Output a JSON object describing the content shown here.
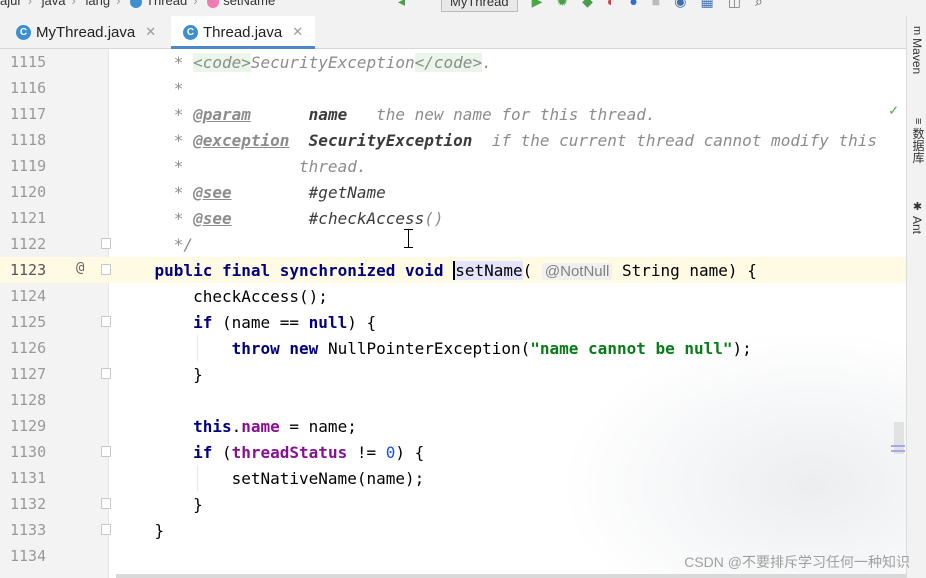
{
  "breadcrumb": {
    "items": [
      "ajur",
      "java",
      "lang",
      "Thread",
      "setName"
    ]
  },
  "toolbar": {
    "run_config": "MyThread",
    "icons": [
      "hammer-icon",
      "run-icon",
      "debug-icon",
      "coverage-icon",
      "profile-icon",
      "stop-icon",
      "search-icon"
    ]
  },
  "tabs": [
    {
      "label": "MyThread.java",
      "icon": "class-icon",
      "active": false
    },
    {
      "label": "Thread.java",
      "icon": "class-icon",
      "active": true
    }
  ],
  "right_tools": [
    "Maven",
    "数据库",
    "Ant"
  ],
  "editor": {
    "current_line": "1123",
    "lines": [
      {
        "n": "1115"
      },
      {
        "n": "1116"
      },
      {
        "n": "1117"
      },
      {
        "n": "1118"
      },
      {
        "n": "1119"
      },
      {
        "n": "1120"
      },
      {
        "n": "1121"
      },
      {
        "n": "1122"
      },
      {
        "n": "1123"
      },
      {
        "n": "1124"
      },
      {
        "n": "1125"
      },
      {
        "n": "1126"
      },
      {
        "n": "1127"
      },
      {
        "n": "1128"
      },
      {
        "n": "1129"
      },
      {
        "n": "1130"
      },
      {
        "n": "1131"
      },
      {
        "n": "1132"
      },
      {
        "n": "1133"
      },
      {
        "n": "1134"
      }
    ],
    "t": {
      "star": "*",
      "code_open": "<code>",
      "security_exception": "SecurityException",
      "code_close": "</code>",
      "dot": ".",
      "param_tag": "@param",
      "name": "name",
      "param_desc": "the new name for this thread.",
      "exception_tag": "@exception",
      "exception_desc": "if the current thread cannot modify this",
      "thread_desc": "thread.",
      "see_tag": "@see",
      "see_get_name": "#getName",
      "see_check_access": "#checkAccess",
      "parens": "()",
      "end_comment": "*/",
      "kw_public": "public",
      "kw_final": "final",
      "kw_synchronized": "synchronized",
      "kw_void": "void",
      "method_name": "setName",
      "open_paren": "(",
      "annotation": "@NotNull",
      "param_decl": "String name) {",
      "check_access_call": "checkAccess();",
      "kw_if": "if",
      "cond1_a": "(name == ",
      "kw_null": "null",
      "cond1_b": ") {",
      "kw_throw": "throw",
      "kw_new": "new",
      "npe": "NullPointerException(",
      "npe_msg": "\"name cannot be null\"",
      "npe_end": ");",
      "close_brace": "}",
      "kw_this": "this",
      "field_name": "name",
      "assign_rest": " = name;",
      "field_thread_status": "threadStatus",
      "cmp": " != ",
      "zero": "0",
      "cond2_end": ") {",
      "paren_open": "(",
      "native_call": "setNativeName(name);",
      "override_mark": "@"
    }
  },
  "watermark": "CSDN @不要排斥学习任何一种知识"
}
